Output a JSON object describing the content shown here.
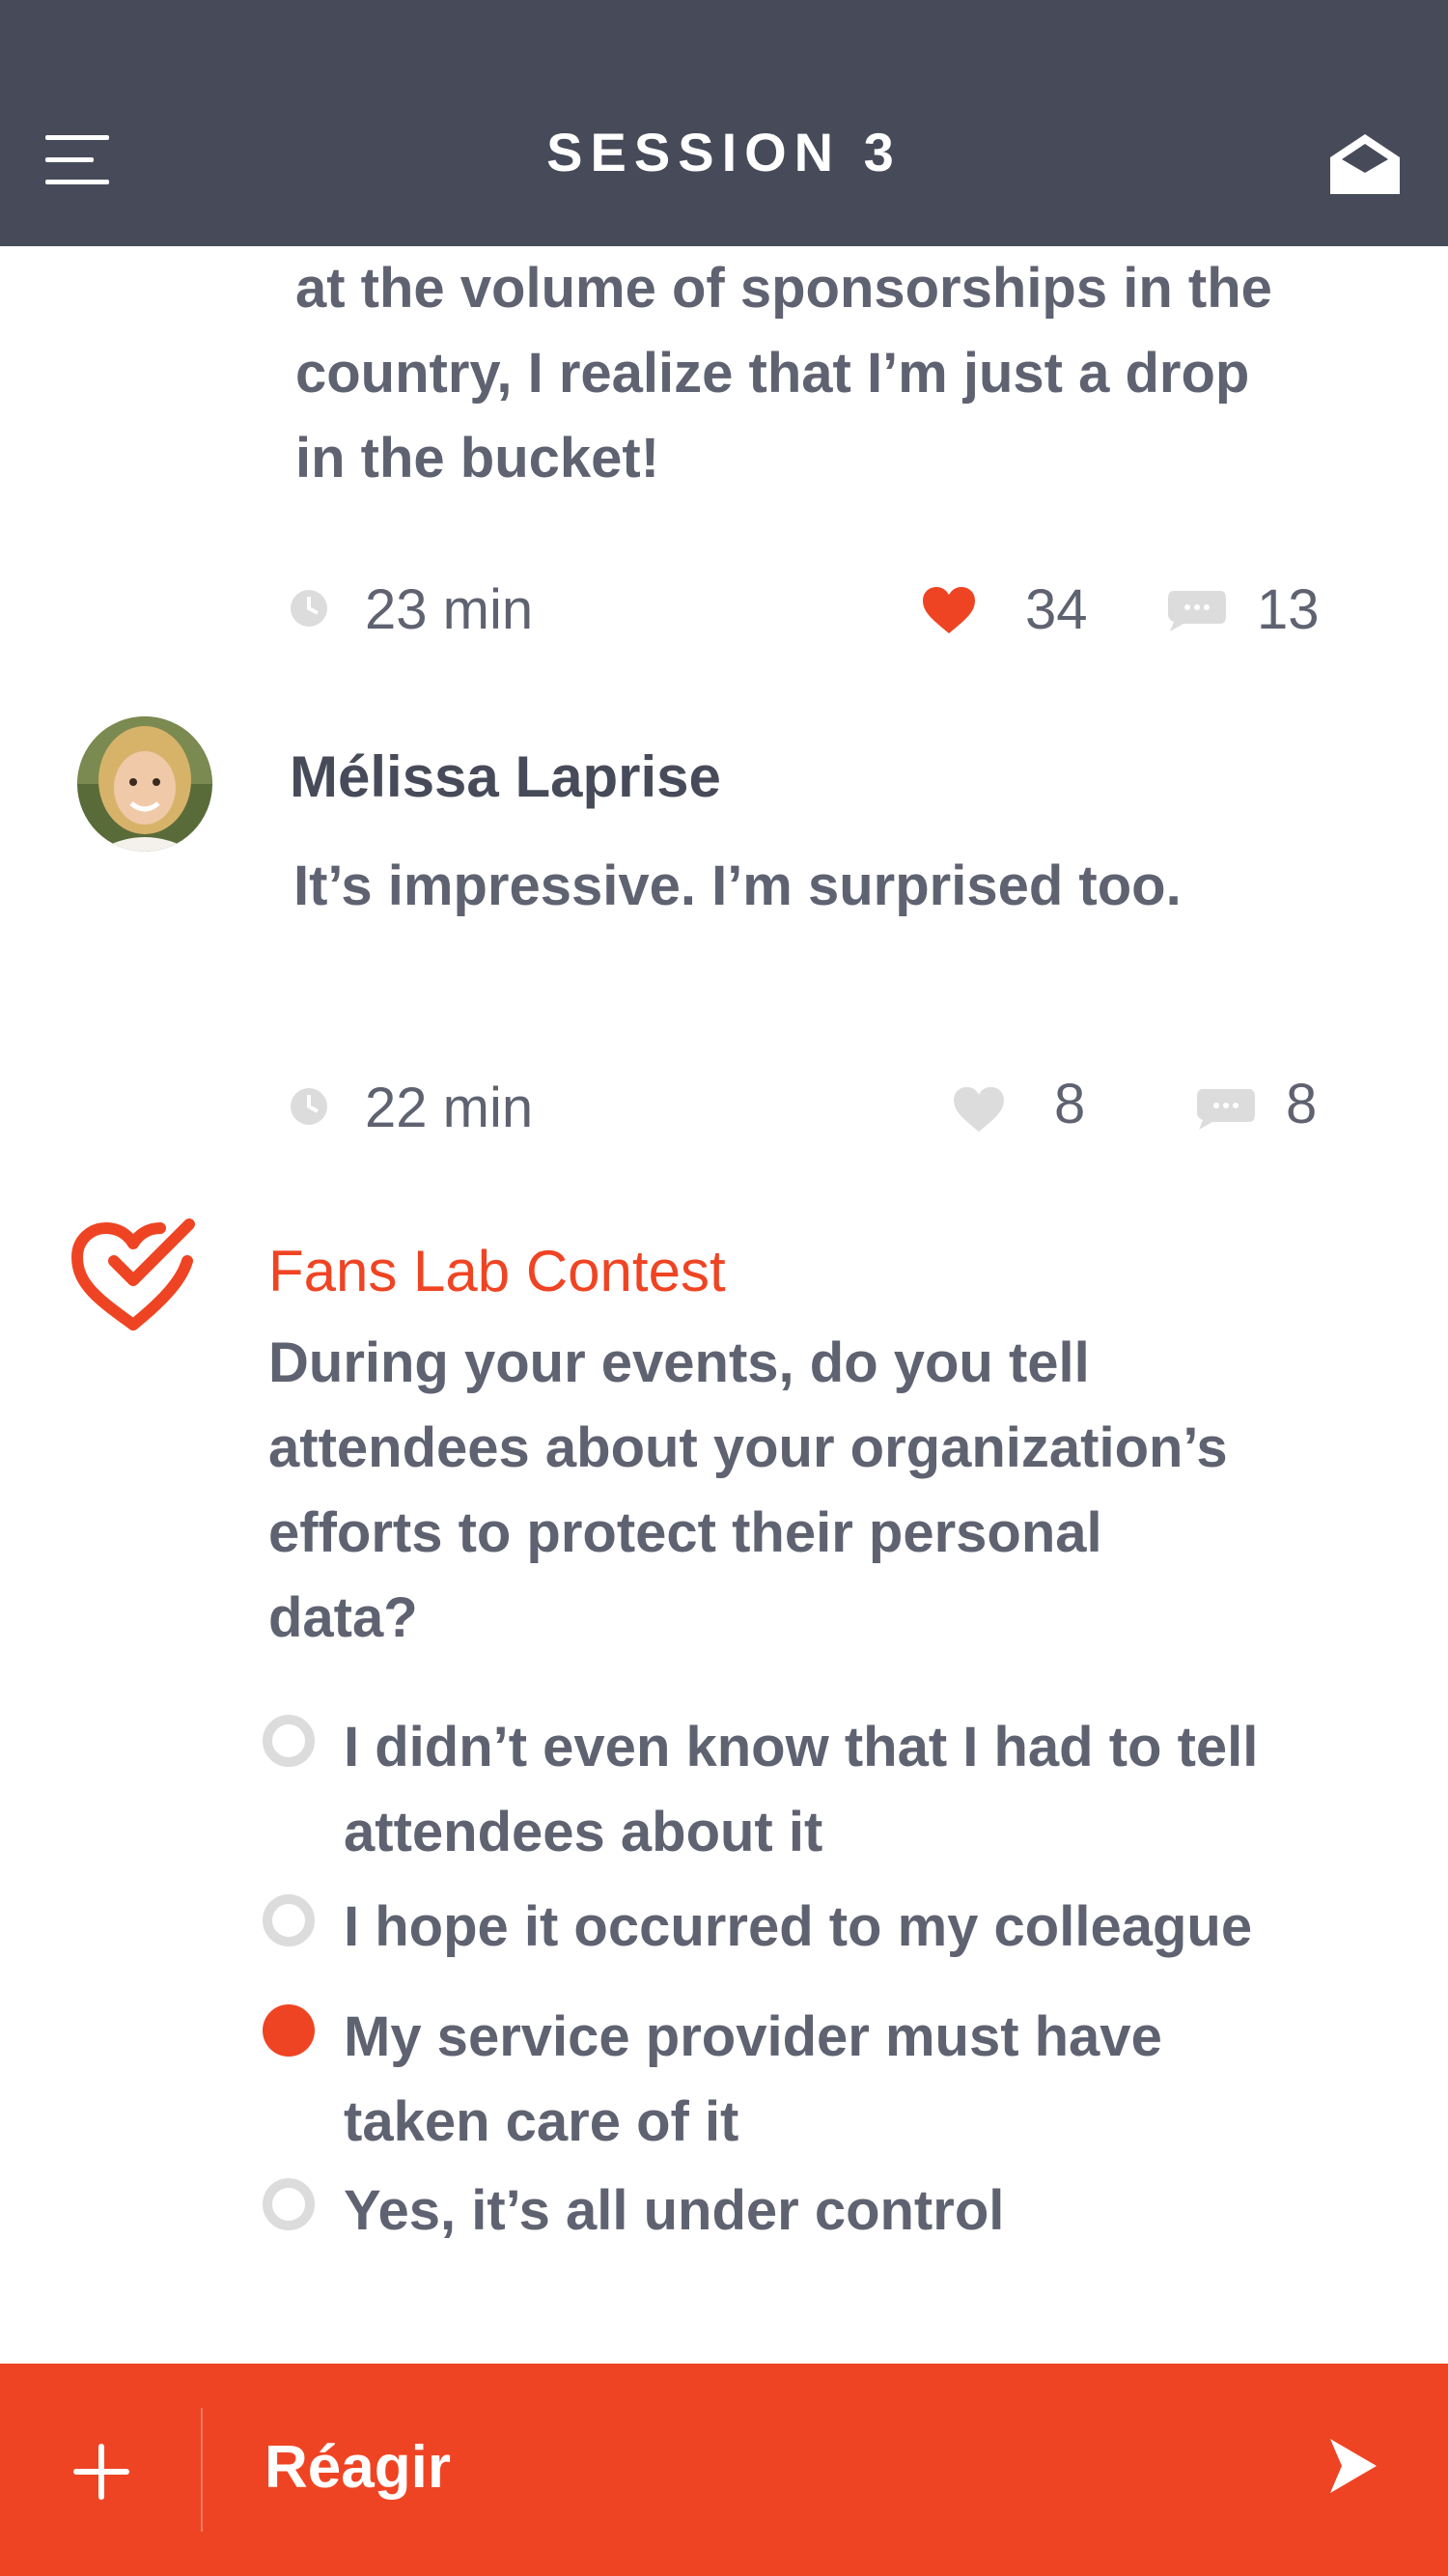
{
  "header": {
    "title": "SESSION 3",
    "menu_icon": "hamburger-menu-icon",
    "mail_icon": "open-envelope-icon"
  },
  "post1": {
    "text_lines": [
      "at the volume of sponsorships in the",
      "country, I realize that I’m just a drop",
      "in the bucket!"
    ],
    "time": "23 min",
    "likes": "34",
    "comments": "13",
    "liked": true
  },
  "post2": {
    "author": "Mélissa Laprise",
    "text": "It’s impressive. I’m surprised too.",
    "time": "22 min",
    "likes": "8",
    "comments": "8",
    "liked": false
  },
  "poll": {
    "title": "Fans Lab Contest",
    "question_lines": [
      "During your events, do you tell",
      "attendees about your organization’s",
      "efforts to protect their personal",
      "data?"
    ],
    "options": [
      {
        "lines": [
          "I didn’t even know that I had to tell",
          "attendees about it"
        ],
        "selected": false
      },
      {
        "lines": [
          "I hope it occurred to my colleague"
        ],
        "selected": false
      },
      {
        "lines": [
          "My service provider must have",
          "taken care of it"
        ],
        "selected": true
      },
      {
        "lines": [
          "Yes, it’s all under control"
        ],
        "selected": false
      }
    ]
  },
  "bottom_bar": {
    "placeholder": "Réagir"
  },
  "colors": {
    "header_bg": "#474b59",
    "accent": "#ef4423",
    "text": "#5f6270",
    "muted_icon": "#dcdcdc"
  }
}
